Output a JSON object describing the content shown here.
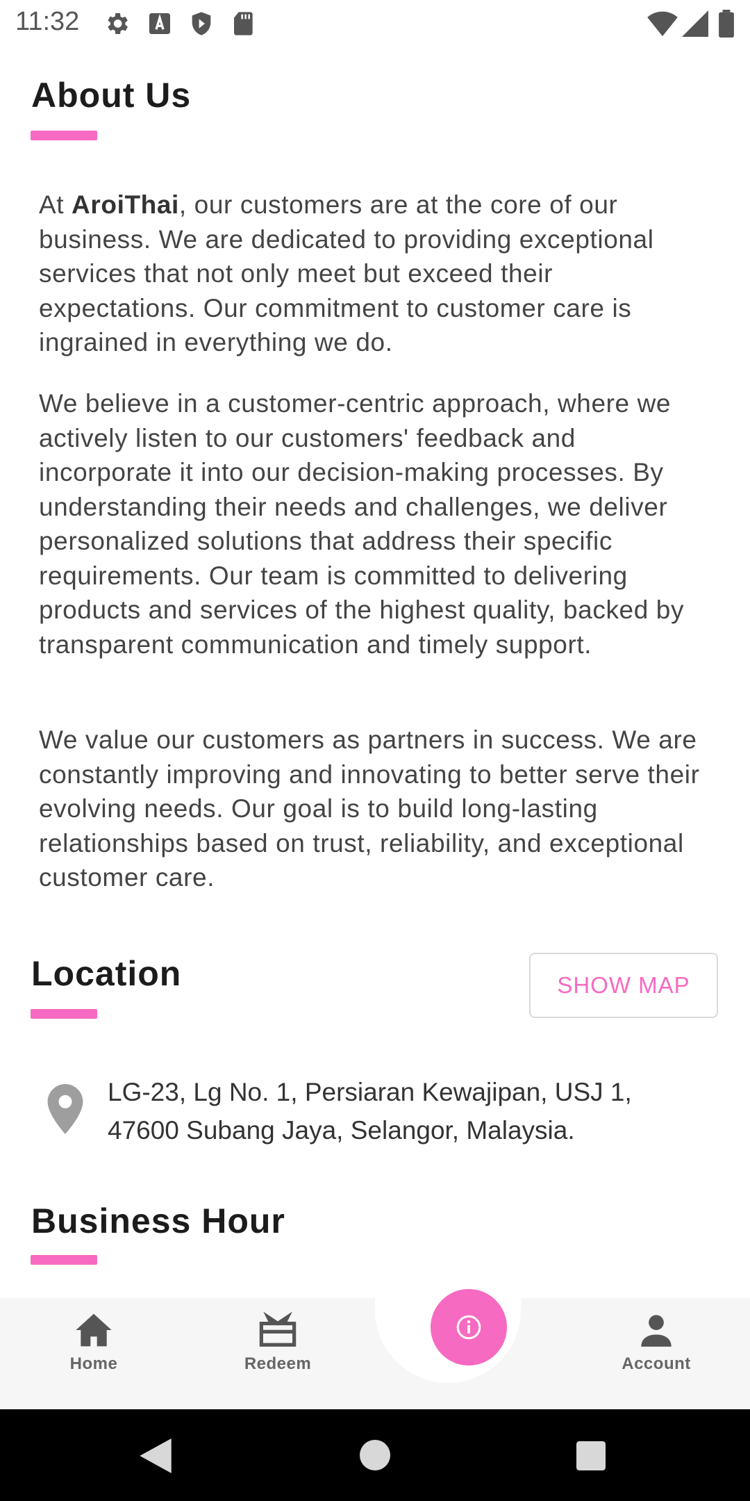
{
  "status_bar": {
    "time": "11:32"
  },
  "about": {
    "title": "About Us",
    "brand": "AroiThai",
    "p1_prefix": "At ",
    "p1_rest": ", our customers are at the core of our business. We are dedicated to providing exceptional services that not only meet but exceed their expectations. Our commitment to customer care is ingrained in everything we do.",
    "p2": "We believe in a customer-centric approach, where we actively listen to our customers' feedback and incorporate it into our decision-making processes. By understanding their needs and challenges, we deliver personalized solutions that address their specific requirements. Our team is committed to delivering products and services of the highest quality, backed by transparent communication and timely support.",
    "p3": "We value our customers as partners in success. We are constantly improving and innovating to better serve their evolving needs. Our goal is to build long-lasting relationships based on trust, reliability, and exceptional customer care."
  },
  "location": {
    "title": "Location",
    "show_map_label": "SHOW MAP",
    "address_line1": "LG-23, Lg No. 1, Persiaran Kewajipan, USJ 1,",
    "address_line2": "47600 Subang Jaya, Selangor, Malaysia."
  },
  "business_hour": {
    "title": "Business Hour"
  },
  "bottom_nav": {
    "home": "Home",
    "redeem": "Redeem",
    "account": "Account",
    "fab_icon": "info-icon"
  },
  "colors": {
    "accent": "#f76ac1",
    "nav_bg": "#f6f6f6"
  }
}
